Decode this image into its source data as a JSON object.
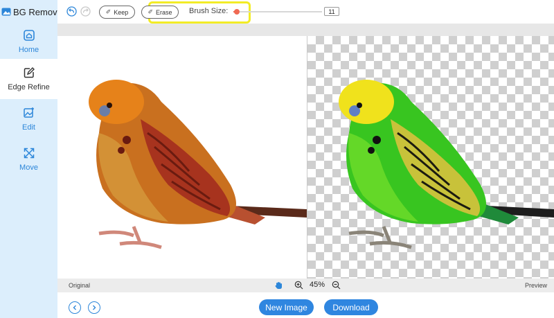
{
  "app": {
    "title": "BG Remover"
  },
  "sidebar": {
    "items": [
      {
        "label": "Home",
        "icon": "home-icon"
      },
      {
        "label": "Edge Refine",
        "icon": "edit-square-icon"
      },
      {
        "label": "Edit",
        "icon": "image-edit-icon"
      },
      {
        "label": "Move",
        "icon": "move-arrows-icon"
      }
    ],
    "active_index": 1
  },
  "toolbar": {
    "keep_label": "Keep",
    "erase_label": "Erase",
    "brush_label": "Brush Size:",
    "brush_value": "11",
    "brush_level_fraction": 0.04
  },
  "status": {
    "original_label": "Original",
    "preview_label": "Preview",
    "zoom_value": "45%"
  },
  "footer": {
    "new_image_label": "New Image",
    "download_label": "Download"
  },
  "colors": {
    "accent": "#2f86e0",
    "sidebar_bg": "#dceefc",
    "highlight": "#f2ec26",
    "slider": "#f06a53"
  }
}
